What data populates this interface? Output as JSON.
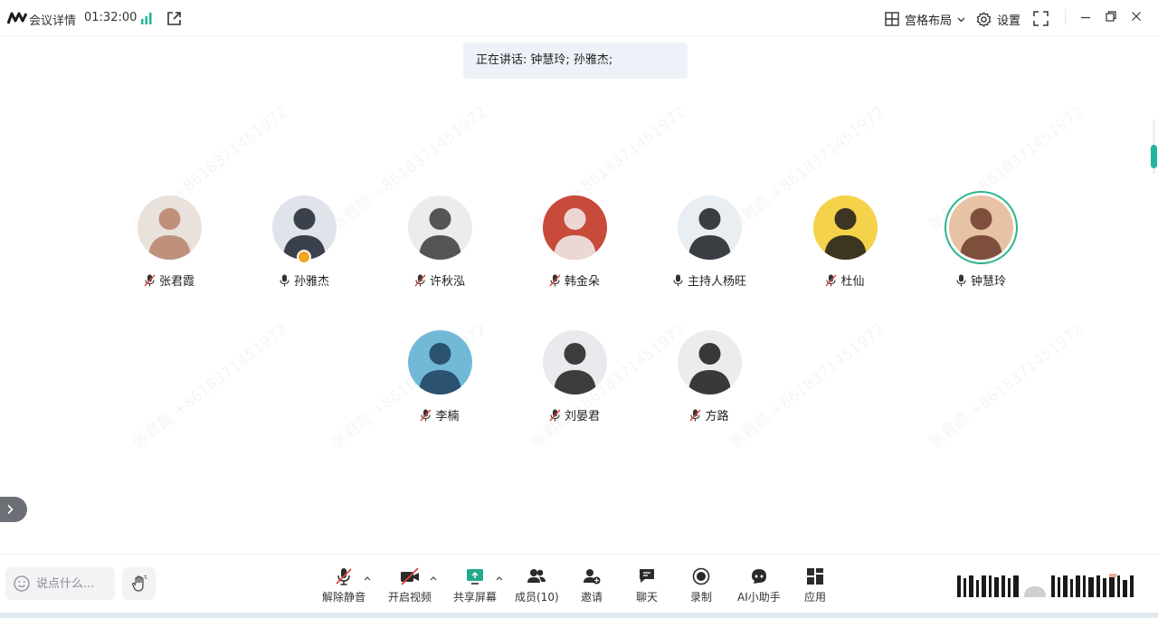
{
  "titlebar": {
    "meeting_info_label": "会议详情",
    "timer": "01:32:00",
    "layout_label": "宫格布局",
    "settings_label": "设置"
  },
  "speaking_banner": {
    "label": "正在讲话:",
    "speakers": "钟慧玲; 孙雅杰;"
  },
  "watermark_text": "张君霞 +8618371451972",
  "participants": [
    {
      "name": "张君霞",
      "mic": "muted",
      "bg": "#e9e2dc",
      "fg": "#b7826b"
    },
    {
      "name": "孙雅杰",
      "mic": "on",
      "bg": "#dfe3ea",
      "fg": "#1f2430",
      "host": true
    },
    {
      "name": "许秋泓",
      "mic": "muted",
      "bg": "#ececec",
      "fg": "#3b3b3b"
    },
    {
      "name": "韩金朵",
      "mic": "muted",
      "bg": "#c84a3a",
      "fg": "#f1f1f1"
    },
    {
      "name": "主持人杨旺",
      "mic": "on",
      "bg": "#e9eef3",
      "fg": "#1b1d22"
    },
    {
      "name": "杜仙",
      "mic": "muted",
      "bg": "#f4d24a",
      "fg": "#1a1a1a"
    },
    {
      "name": "钟慧玲",
      "mic": "on",
      "bg": "#e7c2a4",
      "fg": "#6a3b2a",
      "speaking": true
    },
    {
      "name": "李楠",
      "mic": "muted",
      "bg": "#72b9d8",
      "fg": "#1f3f5e"
    },
    {
      "name": "刘晏君",
      "mic": "muted",
      "bg": "#e9e9ee",
      "fg": "#1f1f1f"
    },
    {
      "name": "方路",
      "mic": "muted",
      "bg": "#ececec",
      "fg": "#1a1a1a"
    }
  ],
  "toolbar": {
    "chat_placeholder": "说点什么...",
    "unmute": "解除静音",
    "start_video": "开启视频",
    "share_screen": "共享屏幕",
    "members": "成员(10)",
    "invite": "邀请",
    "chat": "聊天",
    "record": "录制",
    "ai_assistant": "AI小助手",
    "apps": "应用"
  },
  "colors": {
    "accent": "#21b59b",
    "speaking_ring": "#2bb58c",
    "banner_bg": "#eef1f8",
    "muted_red": "#d9453c"
  }
}
